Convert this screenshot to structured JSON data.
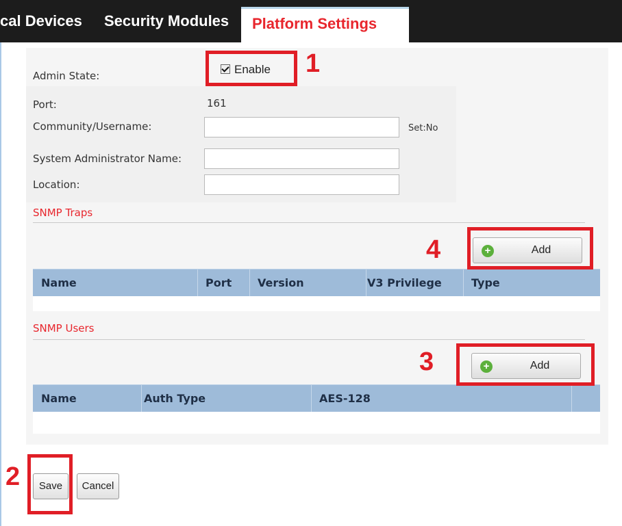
{
  "tabs": [
    {
      "label": "cal Devices"
    },
    {
      "label": "Security Modules"
    },
    {
      "label": "Platform Settings"
    }
  ],
  "form": {
    "admin_state_label": "Admin State:",
    "enable_label": "Enable",
    "enable_checked": true,
    "port_label": "Port:",
    "port_value": "161",
    "community_label": "Community/Username:",
    "community_value": "",
    "set_status": "Set:No",
    "sysadmin_label": "System Administrator Name:",
    "sysadmin_value": "",
    "location_label": "Location:",
    "location_value": ""
  },
  "snmp_traps": {
    "title": "SNMP Traps",
    "add_label": "Add",
    "columns": [
      "Name",
      "Port",
      "Version",
      "V3 Privilege",
      "Type"
    ],
    "rows": []
  },
  "snmp_users": {
    "title": "SNMP Users",
    "add_label": "Add",
    "columns": [
      "Name",
      "Auth Type",
      "AES-128"
    ],
    "rows": []
  },
  "actions": {
    "save_label": "Save",
    "cancel_label": "Cancel"
  },
  "callouts": {
    "c1": "1",
    "c2": "2",
    "c3": "3",
    "c4": "4"
  },
  "colors": {
    "accent": "#e8262d",
    "callout": "#e01e26",
    "grid_header": "#9ebbd9",
    "tabbar": "#1c1c1c"
  }
}
